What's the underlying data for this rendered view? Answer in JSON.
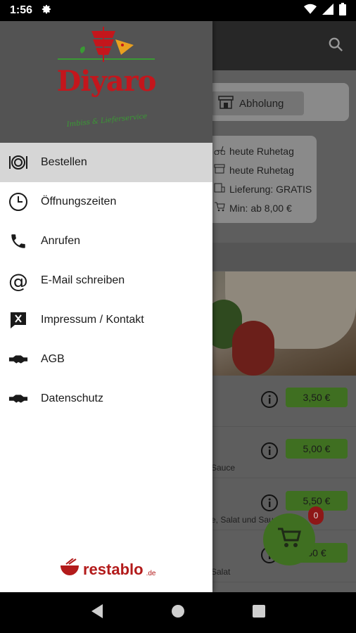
{
  "status": {
    "time": "1:56"
  },
  "background": {
    "pickup_label": "Abholung",
    "info": [
      {
        "icon": "scooter-icon",
        "text": "heute Ruhetag"
      },
      {
        "icon": "store-icon",
        "text": "heute Ruhetag"
      },
      {
        "icon": "delivery-icon",
        "text": "Lieferung: GRATIS"
      },
      {
        "icon": "cart-icon",
        "text": "Min: ab 8,00 €"
      }
    ],
    "items": [
      {
        "price": "3,50 €",
        "desc": ""
      },
      {
        "price": "5,00 €",
        "desc": "Sauce"
      },
      {
        "price": "5,50 €",
        "desc": "e, Salat und Sau"
      },
      {
        "price": "50 €",
        "desc": "Salat"
      }
    ],
    "cart_count": "0"
  },
  "drawer": {
    "logo": {
      "brand": "Diyaro",
      "tagline": "Imbiss & Lieferservice"
    },
    "menu": [
      {
        "label": "Bestellen",
        "icon": "order-icon",
        "active": true
      },
      {
        "label": "Öffnungszeiten",
        "icon": "clock-icon",
        "active": false
      },
      {
        "label": "Anrufen",
        "icon": "phone-icon",
        "active": false
      },
      {
        "label": "E-Mail schreiben",
        "icon": "at-icon",
        "active": false
      },
      {
        "label": "Impressum / Kontakt",
        "icon": "imprint-icon",
        "active": false
      },
      {
        "label": "AGB",
        "icon": "handshake-icon",
        "active": false
      },
      {
        "label": "Datenschutz",
        "icon": "handshake-icon",
        "active": false
      }
    ],
    "footer": {
      "word": "restablo",
      "tld": ".de"
    }
  },
  "colors": {
    "brand_red": "#c4161c",
    "brand_green": "#3a9a34",
    "price_green": "#6aa84f"
  }
}
